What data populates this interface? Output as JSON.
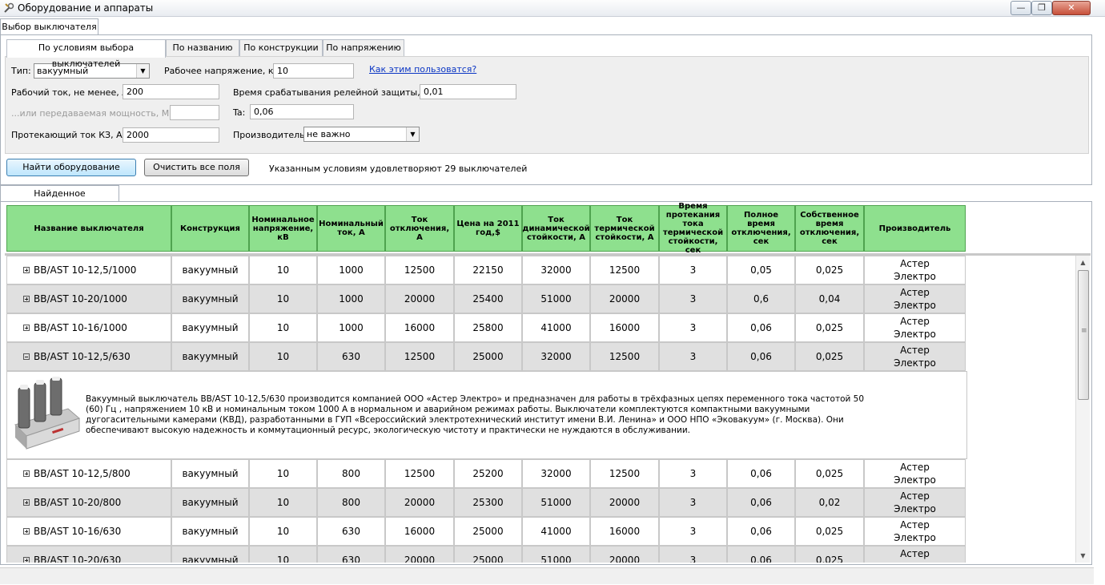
{
  "window": {
    "title": "Оборудование и аппараты",
    "minimize": "—",
    "maximize": "❐",
    "close": "✕"
  },
  "outer_tab": "Выбор выключателя",
  "inner_tabs": [
    "По условиям выбора выключателей",
    "По названию",
    "По конструкции",
    "По напряжению"
  ],
  "form": {
    "type_label": "Тип:",
    "type_value": "вакуумный",
    "voltage_label": "Рабочее напряжение, кВ:",
    "voltage_value": "10",
    "help_link": "Как этим пользоватся?",
    "current_label": "Рабочий ток, не менее, А:",
    "current_value": "200",
    "relay_label": "Время срабатывания релейной защиты, сек:",
    "relay_value": "0,01",
    "power_label": "...или передаваемая мощность, МВА:",
    "power_value": "",
    "ta_label": "Ta:",
    "ta_value": "0,06",
    "sc_label": "Протекающий ток КЗ, А:",
    "sc_value": "2000",
    "maker_label": "Производитель:",
    "maker_value": "не важно"
  },
  "buttons": {
    "find": "Найти оборудование",
    "clear": "Очистить все поля"
  },
  "status": "Указанным условиям удовлетворяют 29 выключателей",
  "results_tab": "Найденное оборудование",
  "columns": [
    "Название выключателя",
    "Конструкция",
    "Номинальное напряжение, кВ",
    "Номинальный ток, А",
    "Ток отключения, А",
    "Цена на 2011 год,$",
    "Ток динамической стойкости, А",
    "Ток термической стойкости, А",
    "Время протекания тока термической стойкости, сек",
    "Полное время отключения, сек",
    "Собственное время отключения, сек",
    "Производитель"
  ],
  "rows": [
    {
      "name": "ВВ/AST 10-12,5/1000",
      "values": [
        "вакуумный",
        "10",
        "1000",
        "12500",
        "22150",
        "32000",
        "12500",
        "3",
        "0,05",
        "0,025",
        "Астер Электро"
      ]
    },
    {
      "name": "ВВ/AST 10-20/1000",
      "values": [
        "вакуумный",
        "10",
        "1000",
        "20000",
        "25400",
        "51000",
        "20000",
        "3",
        "0,6",
        "0,04",
        "Астер Электро"
      ]
    },
    {
      "name": "ВВ/AST 10-16/1000",
      "values": [
        "вакуумный",
        "10",
        "1000",
        "16000",
        "25800",
        "41000",
        "16000",
        "3",
        "0,06",
        "0,025",
        "Астер Электро"
      ]
    },
    {
      "name": "ВВ/AST 10-12,5/630",
      "values": [
        "вакуумный",
        "10",
        "630",
        "12500",
        "25000",
        "32000",
        "12500",
        "3",
        "0,06",
        "0,025",
        "Астер Электро"
      ],
      "expanded": true
    },
    {
      "name": "ВВ/AST 10-12,5/800",
      "values": [
        "вакуумный",
        "10",
        "800",
        "12500",
        "25200",
        "32000",
        "12500",
        "3",
        "0,06",
        "0,025",
        "Астер Электро"
      ]
    },
    {
      "name": "ВВ/AST 10-20/800",
      "values": [
        "вакуумный",
        "10",
        "800",
        "20000",
        "25300",
        "51000",
        "20000",
        "3",
        "0,06",
        "0,02",
        "Астер Электро"
      ]
    },
    {
      "name": "ВВ/AST 10-16/630",
      "values": [
        "вакуумный",
        "10",
        "630",
        "16000",
        "25000",
        "41000",
        "16000",
        "3",
        "0,06",
        "0,025",
        "Астер Электро"
      ]
    },
    {
      "name": "ВВ/AST 10-20/630",
      "values": [
        "вакуумный",
        "10",
        "630",
        "20000",
        "25000",
        "51000",
        "20000",
        "3",
        "0,06",
        "0,025",
        "Астер Электро"
      ]
    }
  ],
  "detail_text": "Вакуумный выключатель ВВ/AST 10-12,5/630 производится компанией ООО «Астер Электро» и предназначен для работы в трёхфазных цепях переменного тока частотой 50 (60) Гц , напряжением 10 кВ и номинальным током 1000 А в нормальном и аварийном режимах работы. Выключатели комплектуются компактными вакуумными дугогасительными камерами (КВД), разработанными в ГУП «Всероссийский электротехнический институт имени В.И. Ленина» и ООО НПО «Эковакуум» (г. Москва). Они обеспечивают высокую надежность и коммутационный ресурс, экологическую чистоту и практически не нуждаются в обслуживании.",
  "colors": {
    "header_bg": "#8ee08e",
    "alt_row": "#e0e0e0",
    "link": "#0b36c4"
  }
}
